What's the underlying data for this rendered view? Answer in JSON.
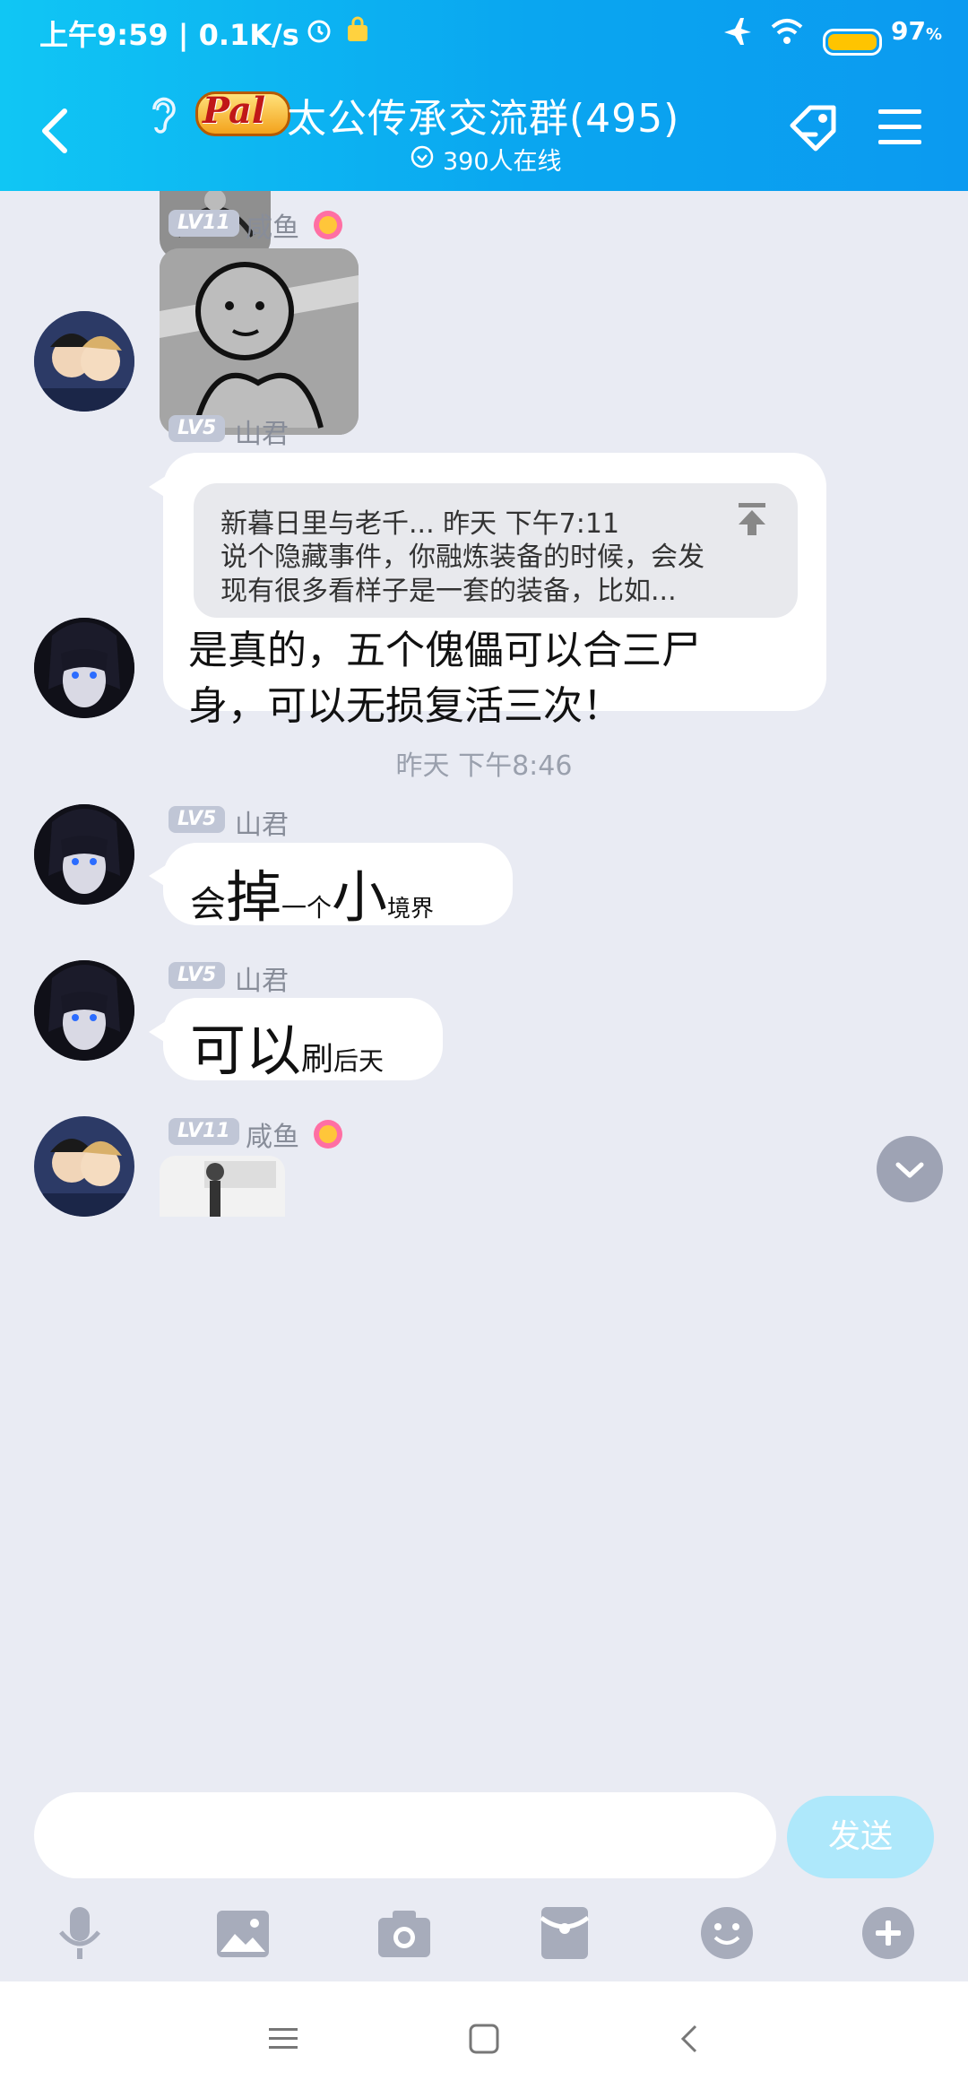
{
  "status_bar": {
    "time_speed": "上午9:59 | 0.1K/s",
    "battery": "97"
  },
  "header": {
    "title": "太公传承交流群(495)",
    "online": "390人在线"
  },
  "messages": [
    {
      "sender": "咸鱼",
      "level": "LV11"
    },
    {
      "sender": "山君",
      "level": "LV5",
      "quote_header": "新暮日里与老千... 昨天 下午7:11",
      "quote_body_line1": "说个隐藏事件，你融炼装备的时候，会发",
      "quote_body_line2": "现有很多看样子是一套的装备，比如...",
      "text_line1": "是真的，五个傀儡可以合三尸",
      "text_line2": "身，可以无损复活三次！"
    },
    {
      "timestamp": "昨天 下午8:46"
    },
    {
      "sender": "山君",
      "level": "LV5",
      "parts": [
        "会",
        "掉",
        "一个",
        "小",
        "境界"
      ]
    },
    {
      "sender": "山君",
      "level": "LV5",
      "parts": [
        "可以",
        "刷",
        "后天"
      ]
    },
    {
      "sender": "咸鱼",
      "level": "LV11"
    }
  ],
  "input": {
    "value": "",
    "send_label": "发送"
  },
  "colors": {
    "header_start": "#10c6f4",
    "header_end": "#0b9af0",
    "send_button": "#aee8fb",
    "chat_background": "#e9ebf3"
  }
}
